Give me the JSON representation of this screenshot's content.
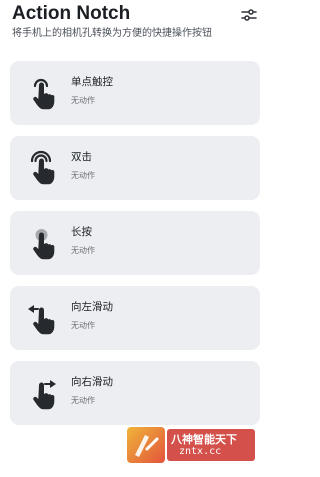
{
  "app": {
    "title": "Action Notch",
    "subtitle": "将手机上的相机孔转换为方便的快捷操作按钮"
  },
  "settings": {
    "icon": "tune-sliders-icon"
  },
  "gestures": [
    {
      "label": "单点触控",
      "action": "无动作",
      "icon": "single-tap-icon"
    },
    {
      "label": "双击",
      "action": "无动作",
      "icon": "double-tap-icon"
    },
    {
      "label": "长按",
      "action": "无动作",
      "icon": "long-press-icon"
    },
    {
      "label": "向左滑动",
      "action": "无动作",
      "icon": "swipe-left-icon"
    },
    {
      "label": "向右滑动",
      "action": "无动作",
      "icon": "swipe-right-icon"
    }
  ],
  "watermark": {
    "line1": "八神智能天下",
    "line2": "zntx.cc"
  },
  "colors": {
    "card_bg": "#eceef1",
    "icon": "#26292d",
    "watermark_red": "#d4504a"
  }
}
